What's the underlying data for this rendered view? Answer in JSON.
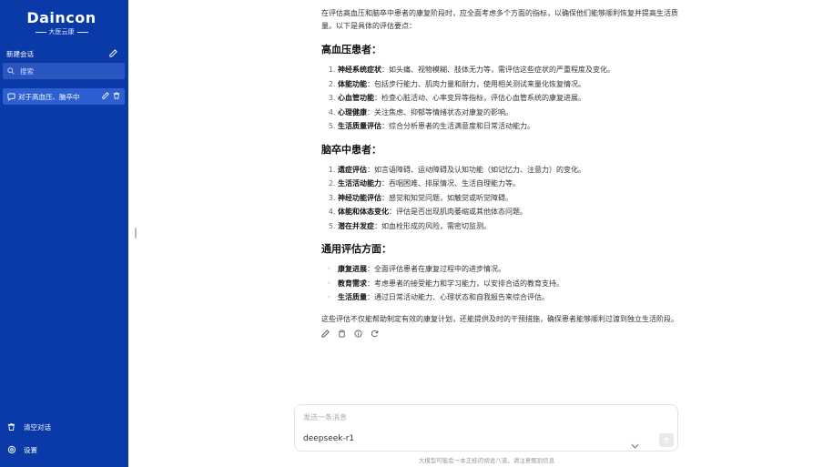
{
  "sidebar": {
    "brand": "Daincon",
    "brand_sub": "大医云康",
    "new_chat_label": "新建会话",
    "search_placeholder": "搜索",
    "conversations": [
      {
        "title": "对于高血压、脑卒中"
      }
    ],
    "clear_label": "清空对话",
    "settings_label": "设置"
  },
  "message": {
    "intro": "在评估高血压和脑卒中患者的康复阶段时，应全面考虑多个方面的指标，以确保他们能够顺利恢复并提高生活质量。以下是具体的评估要点：",
    "sections": [
      {
        "heading": "高血压患者：",
        "ordered": true,
        "items": [
          {
            "term": "神经系统症状",
            "desc": "：如头痛、视物模糊、肢体无力等，需评估这些症状的严重程度及变化。"
          },
          {
            "term": "体能功能",
            "desc": "：包括步行能力、肌肉力量和耐力，使用相关测试来量化恢复情况。"
          },
          {
            "term": "心血管功能",
            "desc": "：检查心脏活动、心率变异等指标，评估心血管系统的康复进展。"
          },
          {
            "term": "心理健康",
            "desc": "：关注焦虑、抑郁等情绪状态对康复的影响。"
          },
          {
            "term": "生活质量评估",
            "desc": "：综合分析患者的生活满意度和日常活动能力。"
          }
        ]
      },
      {
        "heading": "脑卒中患者：",
        "ordered": true,
        "items": [
          {
            "term": "遗症评估",
            "desc": "：如言语障碍、运动障碍及认知功能（如记忆力、注意力）的变化。"
          },
          {
            "term": "生活活动能力",
            "desc": "：吞咽困难、排尿情况、生活自理能力等。"
          },
          {
            "term": "神经功能评估",
            "desc": "：感觉和知觉问题，如触觉或听觉障碍。"
          },
          {
            "term": "体能和体态变化",
            "desc": "：评估是否出现肌肉萎缩或其他体态问题。"
          },
          {
            "term": "潜在并发症",
            "desc": "：如血栓形成的风险，需密切监测。"
          }
        ]
      },
      {
        "heading": "通用评估方面：",
        "ordered": false,
        "items": [
          {
            "term": "康复进展",
            "desc": "：全面评估患者在康复过程中的进步情况。"
          },
          {
            "term": "教育需求",
            "desc": "：考虑患者的接受能力和学习能力，以安排合适的教育支持。"
          },
          {
            "term": "生活质量",
            "desc": "：通过日常活动能力、心理状态和自我报告来综合评估。"
          }
        ]
      }
    ],
    "conclusion": "这些评估不仅能帮助制定有效的康复计划，还能提供及时的干预措施，确保患者能够顺利过渡到独立生活阶段。"
  },
  "input": {
    "placeholder": "发送一条消息",
    "model": "deepseek-r1"
  },
  "footer_note": "大模型可能会一本正经的胡说八道，请注意甄别信息"
}
